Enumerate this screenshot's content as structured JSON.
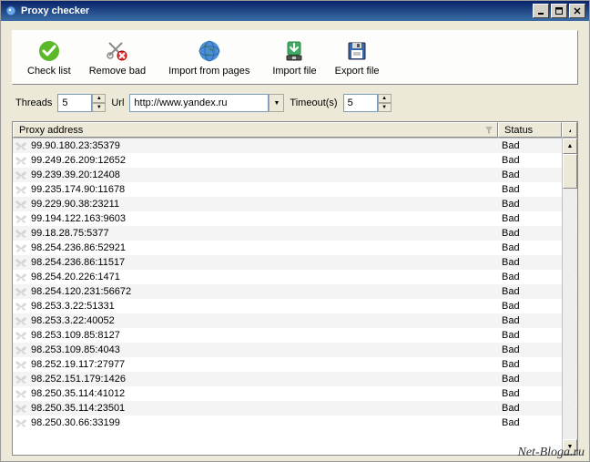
{
  "window": {
    "title": "Proxy checker"
  },
  "toolbar": {
    "check": "Check list",
    "remove": "Remove bad",
    "import_pages": "Import from pages",
    "import_file": "Import file",
    "export_file": "Export file"
  },
  "params": {
    "threads_label": "Threads",
    "threads_value": "5",
    "url_label": "Url",
    "url_value": "http://www.yandex.ru",
    "timeout_label": "Timeout(s)",
    "timeout_value": "5"
  },
  "columns": {
    "address": "Proxy address",
    "status": "Status"
  },
  "rows": [
    {
      "addr": "99.90.180.23:35379",
      "status": "Bad"
    },
    {
      "addr": "99.249.26.209:12652",
      "status": "Bad"
    },
    {
      "addr": "99.239.39.20:12408",
      "status": "Bad"
    },
    {
      "addr": "99.235.174.90:11678",
      "status": "Bad"
    },
    {
      "addr": "99.229.90.38:23211",
      "status": "Bad"
    },
    {
      "addr": "99.194.122.163:9603",
      "status": "Bad"
    },
    {
      "addr": "99.18.28.75:5377",
      "status": "Bad"
    },
    {
      "addr": "98.254.236.86:52921",
      "status": "Bad"
    },
    {
      "addr": "98.254.236.86:11517",
      "status": "Bad"
    },
    {
      "addr": "98.254.20.226:1471",
      "status": "Bad"
    },
    {
      "addr": "98.254.120.231:56672",
      "status": "Bad"
    },
    {
      "addr": "98.253.3.22:51331",
      "status": "Bad"
    },
    {
      "addr": "98.253.3.22:40052",
      "status": "Bad"
    },
    {
      "addr": "98.253.109.85:8127",
      "status": "Bad"
    },
    {
      "addr": "98.253.109.85:4043",
      "status": "Bad"
    },
    {
      "addr": "98.252.19.117:27977",
      "status": "Bad"
    },
    {
      "addr": "98.252.151.179:1426",
      "status": "Bad"
    },
    {
      "addr": "98.250.35.114:41012",
      "status": "Bad"
    },
    {
      "addr": "98.250.35.114:23501",
      "status": "Bad"
    },
    {
      "addr": "98.250.30.66:33199",
      "status": "Bad"
    }
  ],
  "watermark": "Net-Bloga.ru"
}
